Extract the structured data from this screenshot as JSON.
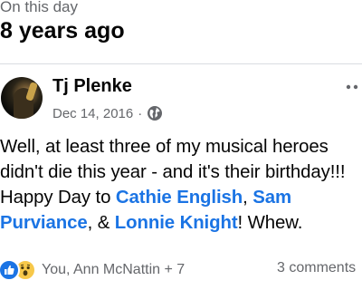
{
  "memory": {
    "label": "On this day",
    "years_ago": "8 years ago"
  },
  "post": {
    "author": "Tj Plenke",
    "date": "Dec 14, 2016",
    "separator": "·",
    "privacy_icon": "globe-icon",
    "more_icon": "more-horizontal-icon",
    "body": {
      "text_1": "Well, at least three of my musical heroes didn't die this year - and it's their birthday!!! Happy Day to ",
      "tag_1": "Cathie English",
      "sep_1": ", ",
      "tag_2": "Sam Purviance",
      "sep_2": ", & ",
      "tag_3": "Lonnie Knight",
      "text_2": "! Whew."
    },
    "reactions": {
      "icons": [
        "like-icon",
        "wow-icon"
      ],
      "names": "You, Ann McNattin + 7"
    },
    "comments": "3 comments"
  },
  "colors": {
    "link": "#1b74e4",
    "secondary_text": "#65676b",
    "primary_text": "#050505",
    "like": "#1b74e4",
    "wow": "#f7c84a"
  }
}
